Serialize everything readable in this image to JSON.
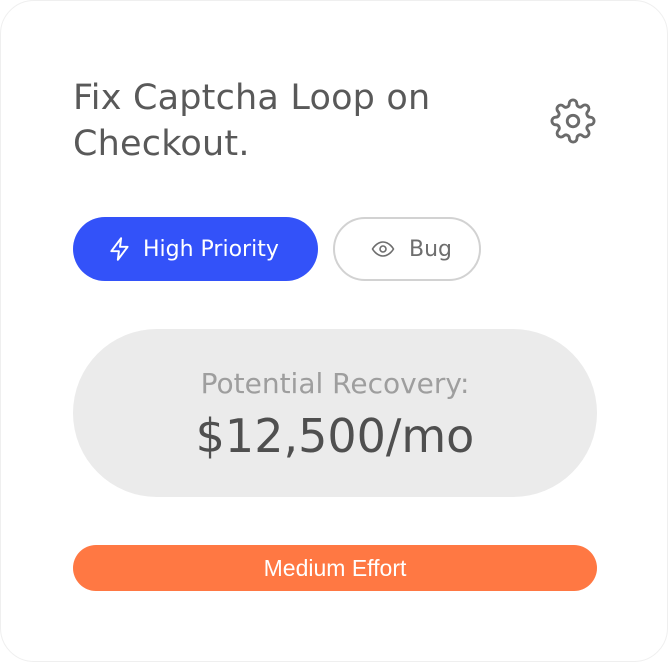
{
  "card": {
    "title": "Fix Captcha Loop on Checkout.",
    "settings_icon": "gear-icon"
  },
  "tags": {
    "priority": {
      "label": "High Priority",
      "icon": "lightning-icon",
      "color": "#3352f9"
    },
    "type": {
      "label": "Bug",
      "icon": "eye-icon"
    }
  },
  "recovery": {
    "label": "Potential Recovery:",
    "value": "$12,500/mo"
  },
  "effort": {
    "label": "Medium Effort",
    "color": "#ff7843"
  }
}
